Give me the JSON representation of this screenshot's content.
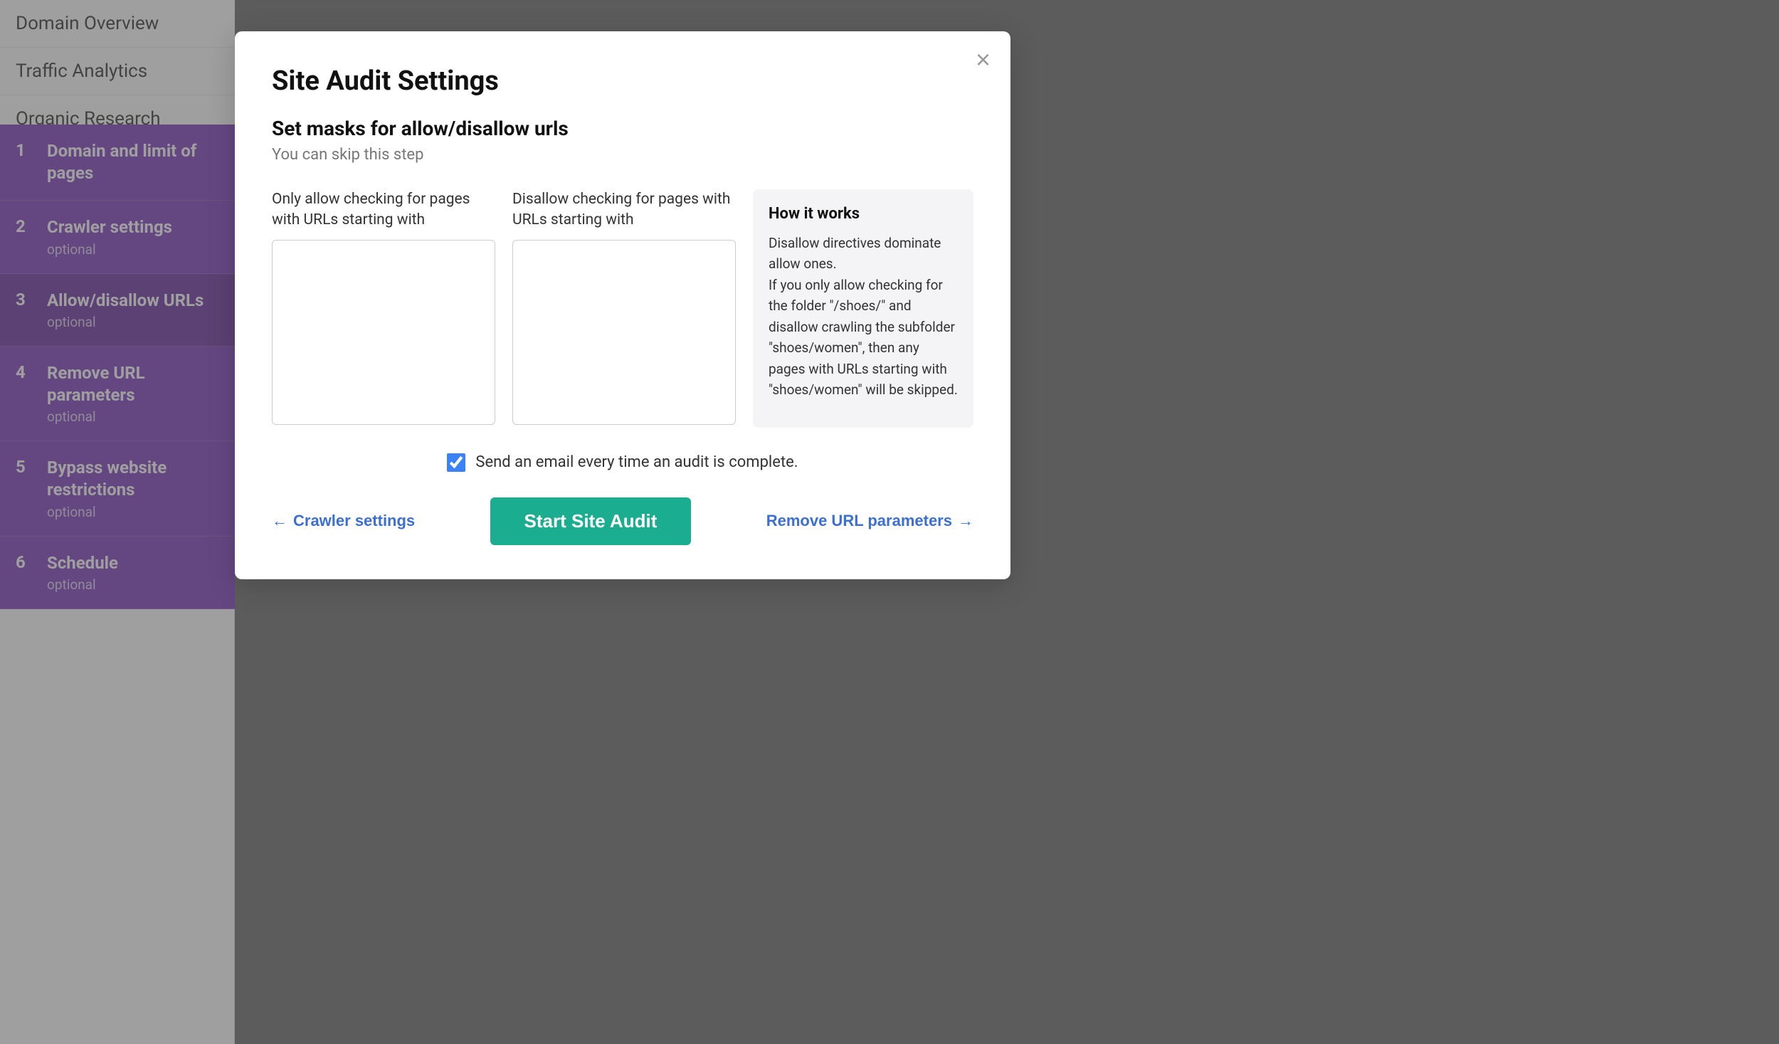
{
  "sidebar": {
    "plain_items": [
      {
        "label": "Domain Overview"
      },
      {
        "label": "Traffic Analytics"
      },
      {
        "label": "Organic Research"
      }
    ],
    "steps": [
      {
        "number": "1",
        "name": "Domain and limit of pages",
        "optional": "",
        "active": false,
        "inactive": true
      },
      {
        "number": "2",
        "name": "Crawler settings",
        "optional": "optional",
        "active": false,
        "inactive": true
      },
      {
        "number": "3",
        "name": "Allow/disallow URLs",
        "optional": "optional",
        "active": true,
        "inactive": false
      },
      {
        "number": "4",
        "name": "Remove URL parameters",
        "optional": "optional",
        "active": false,
        "inactive": true
      },
      {
        "number": "5",
        "name": "Bypass website restrictions",
        "optional": "optional",
        "active": false,
        "inactive": true
      },
      {
        "number": "6",
        "name": "Schedule",
        "optional": "optional",
        "active": false,
        "inactive": true
      }
    ]
  },
  "modal": {
    "title": "Site Audit Settings",
    "close_label": "×",
    "section_title": "Set masks for allow/disallow urls",
    "skip_text": "You can skip this step",
    "allow_label": "Only allow checking for pages with URLs starting with",
    "disallow_label": "Disallow checking for pages with URLs starting with",
    "info_box": {
      "title": "How it works",
      "text": "Disallow directives dominate allow ones.\nIf you only allow checking for the folder \"/shoes/\" and disallow crawling the subfolder \"shoes/women\", then any pages with URLs starting with \"shoes/women\" will be skipped."
    },
    "email_label": "Send an email every time an audit is complete.",
    "email_checked": true,
    "nav_back_label": "Crawler settings",
    "start_label": "Start Site Audit",
    "nav_next_label": "Remove URL parameters"
  }
}
